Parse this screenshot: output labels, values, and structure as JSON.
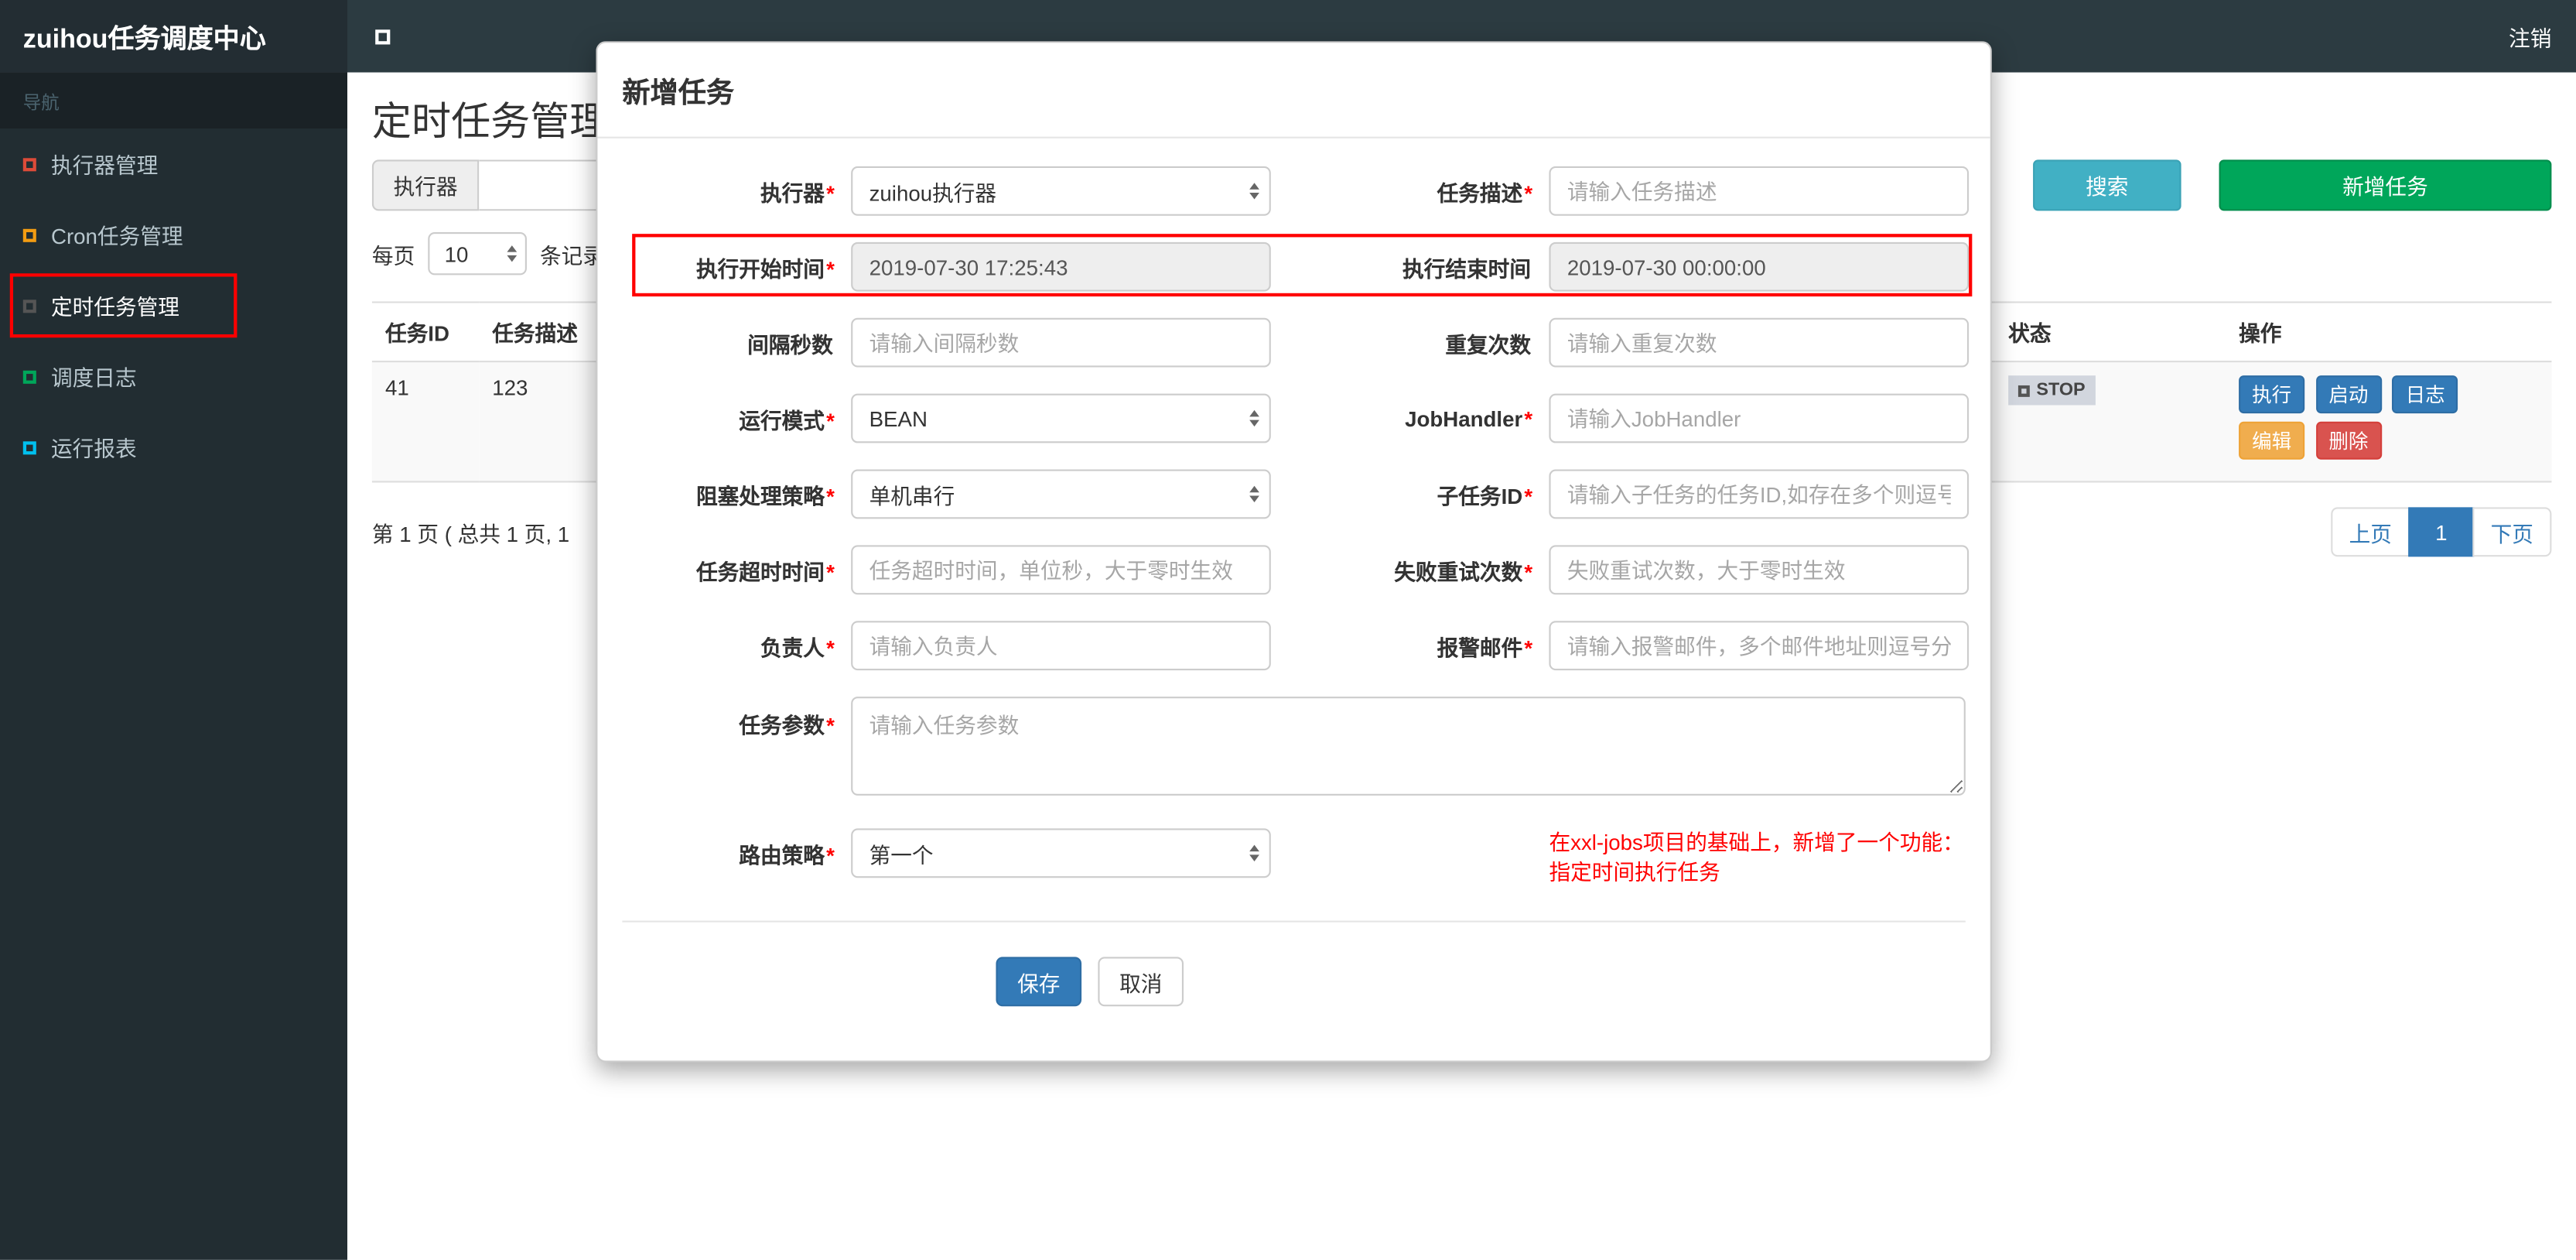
{
  "colors": {
    "accent_blue": "#337ab7",
    "success_green": "#00a65a",
    "info_teal": "#41b0c4",
    "warning_orange": "#f0ad4e",
    "danger_red": "#d9534f",
    "annotation_red": "#ff0000",
    "navbar_dark": "#2c3b41",
    "sidebar_dark": "#222d32"
  },
  "navbar": {
    "brand": "zuihou任务调度中心",
    "logout": "注销"
  },
  "sidebar": {
    "header": "导航",
    "items": [
      {
        "label": "执行器管理",
        "icon_color": "#dd4b39"
      },
      {
        "label": "Cron任务管理",
        "icon_color": "#f39c12"
      },
      {
        "label": "定时任务管理",
        "icon_color": "#555555",
        "highlighted": true
      },
      {
        "label": "调度日志",
        "icon_color": "#00a65a"
      },
      {
        "label": "运行报表",
        "icon_color": "#00c0ef"
      }
    ]
  },
  "page": {
    "title": "定时任务管理",
    "filter": {
      "addon": "执行器",
      "search": "搜索",
      "add": "新增任务"
    },
    "perpage": {
      "prefix": "每页",
      "value": "10",
      "suffix": "条记录"
    },
    "table": {
      "headers": [
        "任务ID",
        "任务描述",
        "状态",
        "操作"
      ],
      "row": {
        "id": "41",
        "desc": "123",
        "status_label": "STOP",
        "actions": [
          "执行",
          "启动",
          "日志",
          "编辑",
          "删除"
        ]
      }
    },
    "pagination": {
      "info": "第 1 页 ( 总共 1 页, 1",
      "prev": "上页",
      "page": "1",
      "next": "下页"
    }
  },
  "modal": {
    "title": "新增任务",
    "rows": [
      {
        "left": {
          "label": "执行器",
          "star": "*",
          "value": "zuihou执行器"
        },
        "right": {
          "label": "任务描述",
          "star": "*",
          "placeholder": "请输入任务描述"
        }
      },
      {
        "left": {
          "label": "执行开始时间",
          "star": "*",
          "value": "2019-07-30 17:25:43"
        },
        "right": {
          "label": "执行结束时间",
          "star": "",
          "value": "2019-07-30 00:00:00"
        }
      },
      {
        "left": {
          "label": "间隔秒数",
          "star": "",
          "placeholder": "请输入间隔秒数"
        },
        "right": {
          "label": "重复次数",
          "star": "",
          "placeholder": "请输入重复次数"
        }
      },
      {
        "left": {
          "label": "运行模式",
          "star": "*",
          "value": "BEAN"
        },
        "right": {
          "label": "JobHandler",
          "star": "*",
          "placeholder": "请输入JobHandler"
        }
      },
      {
        "left": {
          "label": "阻塞处理策略",
          "star": "*",
          "value": "单机串行"
        },
        "right": {
          "label": "子任务ID",
          "star": "*",
          "placeholder": "请输入子任务的任务ID,如存在多个则逗号分隔"
        }
      },
      {
        "left": {
          "label": "任务超时时间",
          "star": "*",
          "placeholder": "任务超时时间，单位秒，大于零时生效"
        },
        "right": {
          "label": "失败重试次数",
          "star": "*",
          "placeholder": "失败重试次数，大于零时生效"
        }
      },
      {
        "left": {
          "label": "负责人",
          "star": "*",
          "placeholder": "请输入负责人"
        },
        "right": {
          "label": "报警邮件",
          "star": "*",
          "placeholder": "请输入报警邮件，多个邮件地址则逗号分隔"
        }
      }
    ],
    "params": {
      "label": "任务参数",
      "star": "*",
      "placeholder": "请输入任务参数"
    },
    "route": {
      "label": "路由策略",
      "star": "*",
      "value": "第一个"
    },
    "note1": "在xxl-jobs项目的基础上，新增了一个功能：",
    "note2": "指定时间执行任务",
    "save": "保存",
    "cancel": "取消"
  }
}
